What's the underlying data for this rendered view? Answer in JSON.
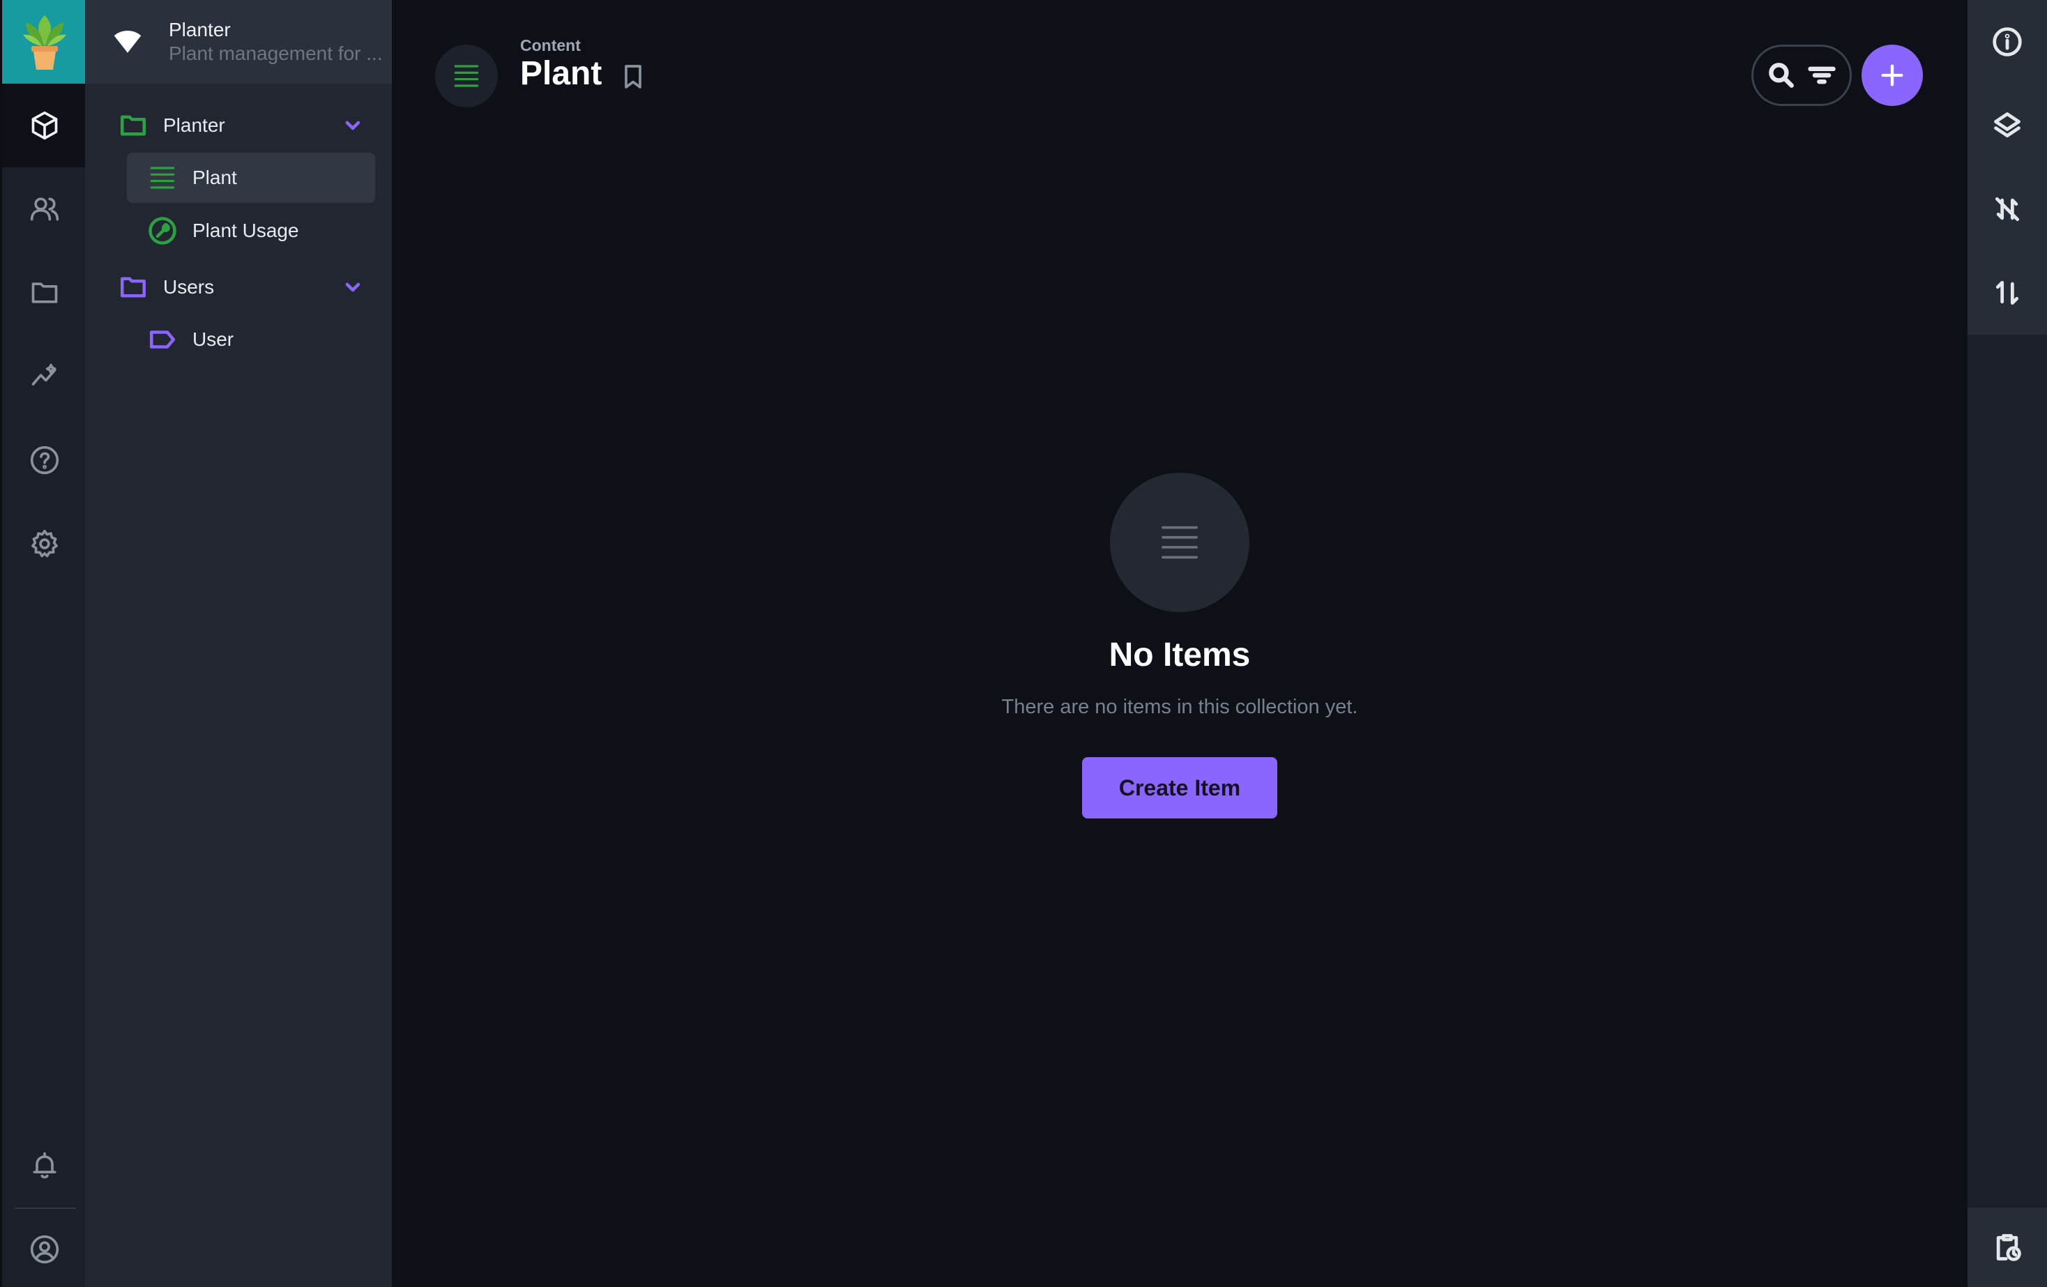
{
  "project": {
    "name": "Planter",
    "description": "Plant management for ..."
  },
  "modules": [
    {
      "name": "content-icon",
      "active": true
    },
    {
      "name": "users-icon"
    },
    {
      "name": "files-icon"
    },
    {
      "name": "insights-icon"
    },
    {
      "name": "help-icon"
    },
    {
      "name": "settings-icon"
    },
    {
      "name": "notifications-icon"
    },
    {
      "name": "user-profile-icon"
    }
  ],
  "navigation": {
    "groups": [
      {
        "label": "Planter",
        "color": "#2ea043",
        "children": [
          {
            "label": "Plant",
            "icon": "list-icon",
            "selected": true,
            "color": "#2ea043"
          },
          {
            "label": "Plant Usage",
            "icon": "wrench-circle-icon",
            "color": "#2ea043"
          }
        ]
      },
      {
        "label": "Users",
        "color": "#8a66ff",
        "children": [
          {
            "label": "User",
            "icon": "label-icon",
            "color": "#8a66ff"
          }
        ]
      }
    ]
  },
  "header": {
    "breadcrumb": "Content",
    "title": "Plant"
  },
  "empty_state": {
    "title": "No Items",
    "subtitle": "There are no items in this collection yet.",
    "button_label": "Create Item"
  },
  "right_sidebar": [
    "info-icon",
    "layers-icon",
    "sync-off-icon",
    "import-export-icon",
    "revisions-icon"
  ],
  "colors": {
    "accent": "#8a66ff",
    "planter_green": "#2ea043",
    "background": "#0d1117"
  }
}
